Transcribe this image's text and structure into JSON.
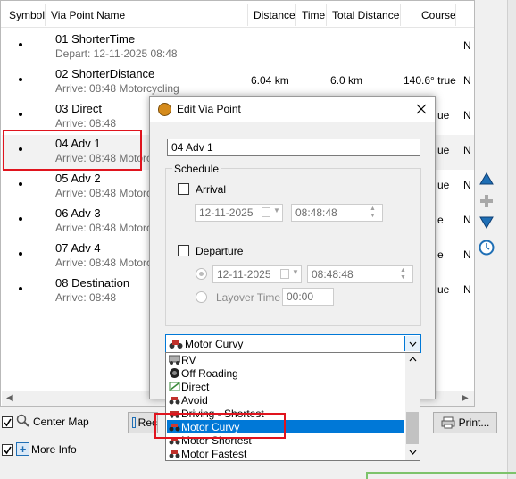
{
  "columns": [
    "Symbol",
    "Via Point Name",
    "Distance",
    "Time",
    "Total Distance",
    "Course"
  ],
  "rows": [
    {
      "name": "01 ShorterTime",
      "sub": "Depart: 12-11-2025 08:48",
      "distance": "",
      "total": "",
      "course": "",
      "extra": "N"
    },
    {
      "name": "02 ShorterDistance",
      "sub": "Arrive: 08:48   Motorcycling",
      "distance": "6.04 km",
      "total": "6.0 km",
      "course": "140.6° true",
      "extra": "N"
    },
    {
      "name": "03 Direct",
      "sub": "Arrive: 08:48",
      "distance": "",
      "total": "",
      "course": "ue",
      "extra": "N"
    },
    {
      "name": "04 Adv 1",
      "sub": "Arrive: 08:48   Motorcyc",
      "distance": "",
      "total": "",
      "course": "ue",
      "extra": "N"
    },
    {
      "name": "05 Adv 2",
      "sub": "Arrive: 08:48   Motorcy",
      "distance": "",
      "total": "",
      "course": "ue",
      "extra": "N"
    },
    {
      "name": "06 Adv 3",
      "sub": "Arrive: 08:48   Motorcy",
      "distance": "",
      "total": "",
      "course": "e",
      "extra": "N"
    },
    {
      "name": "07 Adv 4",
      "sub": "Arrive: 08:48   Motorcy",
      "distance": "",
      "total": "",
      "course": "e",
      "extra": "N"
    },
    {
      "name": "08 Destination",
      "sub": "Arrive: 08:48",
      "distance": "",
      "total": "",
      "course": "ue",
      "extra": "N"
    }
  ],
  "bottom": {
    "center_map": "Center Map",
    "more_info": "More Info",
    "rec_partial": "Rec",
    "print": "Print..."
  },
  "dialog": {
    "title": "Edit Via Point",
    "name_value": "04 Adv 1",
    "schedule_label": "Schedule",
    "arrival_label": "Arrival",
    "arrival_date": "12-11-2025",
    "arrival_time": "08:48:48",
    "departure_label": "Departure",
    "departure_date": "12-11-2025",
    "departure_time": "08:48:48",
    "layover_label": "Layover Time",
    "layover_value": "00:00",
    "route_selected": "Motor Curvy"
  },
  "dropdown": {
    "options": [
      "RV",
      "Off Roading",
      "Direct",
      "Avoid",
      "Driving - Shortest",
      "Motor Curvy",
      "Motor Shortest",
      "Motor Fastest"
    ],
    "selected": "Motor Curvy"
  },
  "colors": {
    "highlight_red": "#e0141e",
    "selection_blue": "#0078d7",
    "nav_blue": "#1f6fb5"
  }
}
